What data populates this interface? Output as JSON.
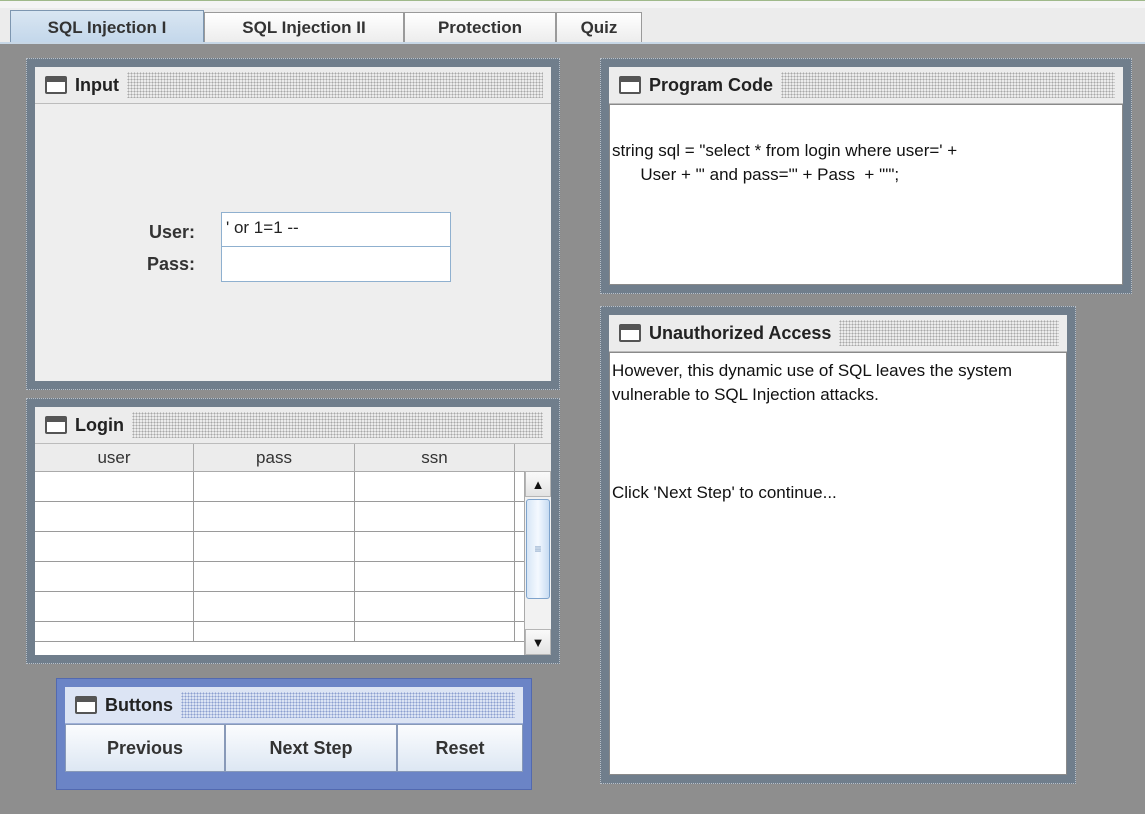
{
  "tabs": [
    {
      "label": "SQL Injection I",
      "active": true
    },
    {
      "label": "SQL Injection II",
      "active": false
    },
    {
      "label": "Protection",
      "active": false
    },
    {
      "label": "Quiz",
      "active": false
    }
  ],
  "input_frame": {
    "title": "Input",
    "user_label": "User:",
    "user_value": "' or 1=1 --",
    "pass_label": "Pass:",
    "pass_value": ""
  },
  "login_frame": {
    "title": "Login",
    "columns": [
      "user",
      "pass",
      "ssn"
    ],
    "rows": [
      [
        "",
        "",
        ""
      ],
      [
        "",
        "",
        ""
      ],
      [
        "",
        "",
        ""
      ],
      [
        "",
        "",
        ""
      ],
      [
        "",
        "",
        ""
      ],
      [
        "",
        "",
        ""
      ]
    ]
  },
  "buttons_frame": {
    "title": "Buttons",
    "previous_label": "Previous",
    "next_label": "Next Step",
    "reset_label": "Reset"
  },
  "code_frame": {
    "title": "Program Code",
    "code_line1": "string sql = \"select * from login where user=' +",
    "code_line2": "      User + \"' and pass='\" + Pass  + \"'\";"
  },
  "access_frame": {
    "title": "Unauthorized Access",
    "message1": "However, this dynamic use of SQL leaves the system vulnerable to SQL Injection attacks.",
    "message2": "Click 'Next Step' to continue..."
  },
  "colors": {
    "desktop": "#8e8e8e",
    "frame_border": "#707e8c",
    "buttons_frame": "#6b84c6",
    "active_tab": "#c2d6ea"
  }
}
